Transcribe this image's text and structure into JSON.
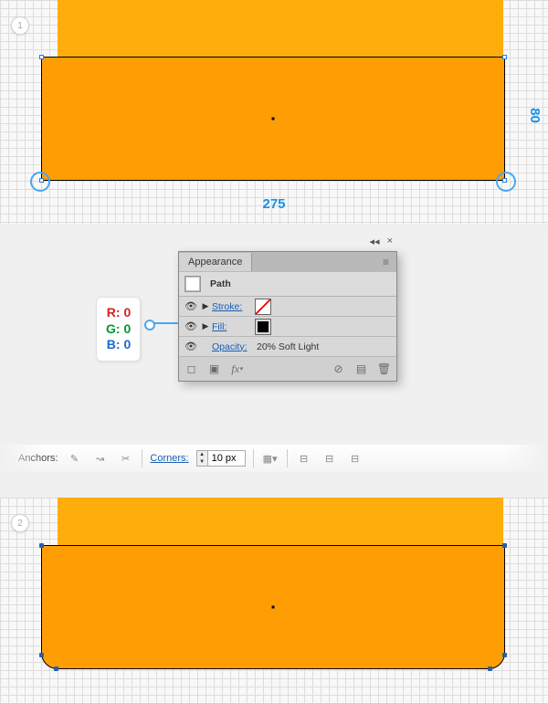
{
  "step1": {
    "num": "1",
    "width_label": "275",
    "height_label": "80"
  },
  "step2": {
    "num": "2"
  },
  "rgb": {
    "r": "R: 0",
    "g": "G: 0",
    "b": "B: 0"
  },
  "panel": {
    "tab": "Appearance",
    "object_type": "Path",
    "stroke_label": "Stroke:",
    "fill_label": "Fill:",
    "opacity_label": "Opacity:",
    "opacity_value": "20% Soft Light",
    "flyout_menu": "≡",
    "flyout_close": "×",
    "flyout_collapse": "◂◂"
  },
  "controlbar": {
    "anchors_label": "Anchors:",
    "corners_label": "Corners:",
    "corner_value": "10 px"
  }
}
